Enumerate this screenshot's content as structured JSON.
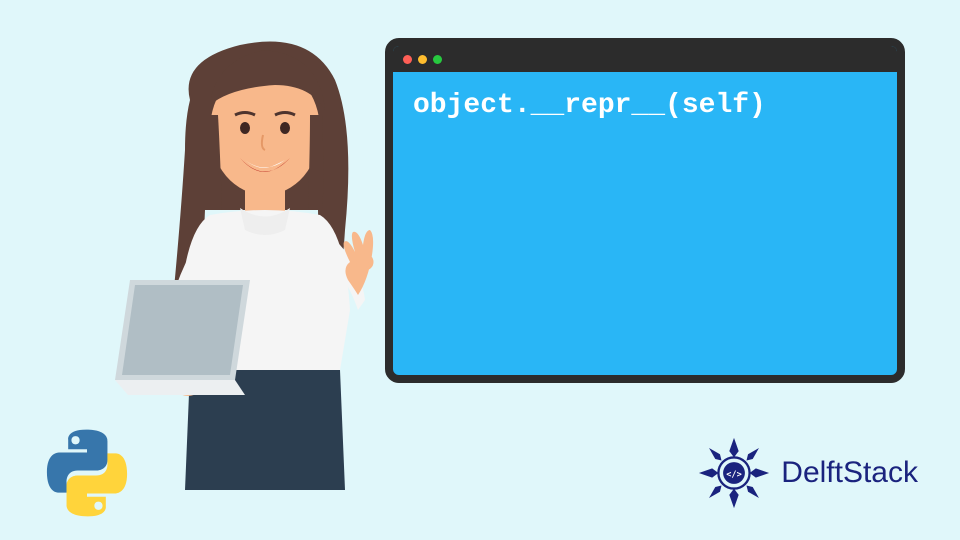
{
  "terminal": {
    "code": "object.__repr__(self)"
  },
  "brand": {
    "name": "DelftStack"
  },
  "icons": {
    "python": "python-logo",
    "delft_mandala": "mandala-icon"
  },
  "colors": {
    "bg": "#e0f7fa",
    "terminal_bg": "#29b6f6",
    "border": "#2c2c2c",
    "brand": "#1a237e"
  }
}
